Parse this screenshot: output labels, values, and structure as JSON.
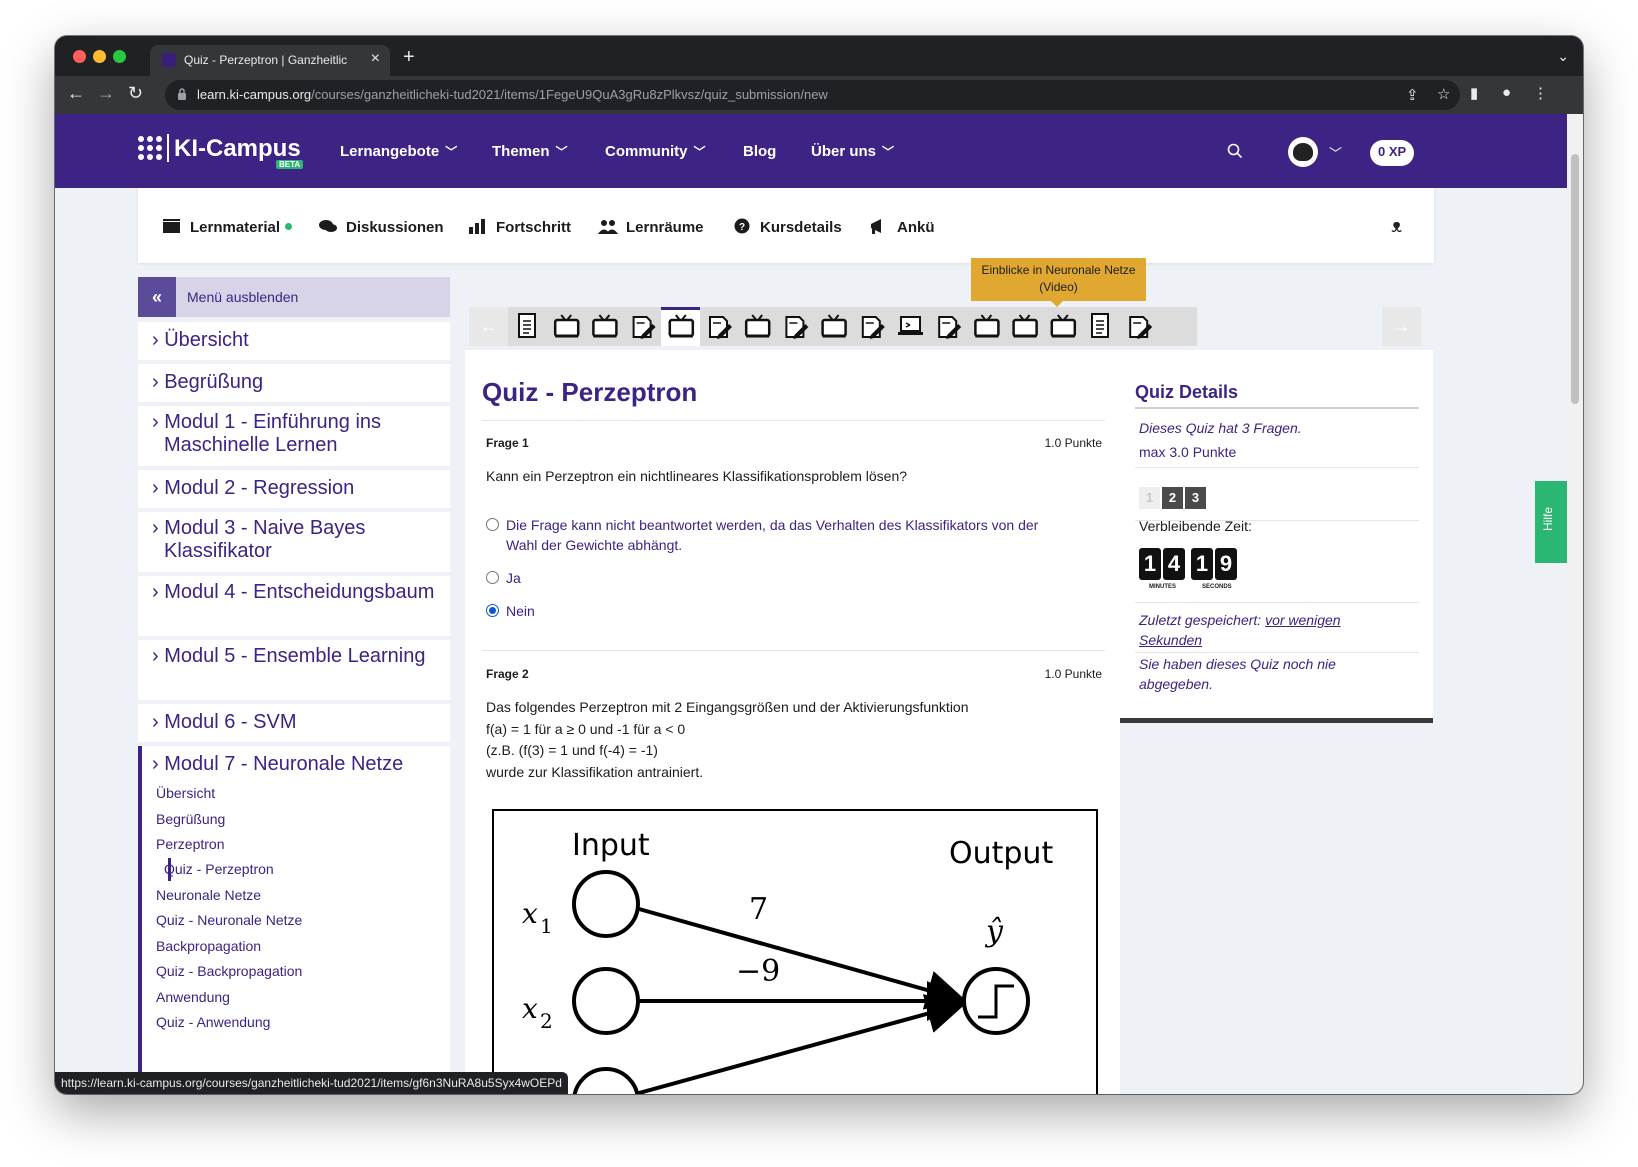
{
  "browser": {
    "tab_title": "Quiz - Perzeptron | Ganzheitlic",
    "tab_close": "×",
    "new_tab": "+",
    "url_host": "learn.ki-campus.org",
    "url_path": "/courses/ganzheitlicheki-tud2021/items/1FegeU9QuA3gRu8zPlkvsz/quiz_submission/new",
    "status_url": "https://learn.ki-campus.org/courses/ganzheitlicheki-tud2021/items/gf6n3NuRA8u5Syx4wOEPd"
  },
  "site": {
    "logo": "KI-Campus",
    "beta": "BETA",
    "nav": [
      "Lernangebote",
      "Themen",
      "Community",
      "Blog",
      "Über uns"
    ],
    "xp": "0 XP"
  },
  "course_tabs": {
    "items": [
      "Lernmaterial",
      "Diskussionen",
      "Fortschritt",
      "Lernräume",
      "Kursdetails",
      "Ankü"
    ],
    "tooltip": "Einblicke in Neuronale Netze (Video)"
  },
  "sidebar": {
    "toggle_label": "Menü ausblenden",
    "modules": [
      "› Übersicht",
      "› Begrüßung",
      "› Modul 1 - Einführung ins Maschinelle Lernen",
      "› Modul 2 - Regression",
      "› Modul 3 - Naive Bayes Klassifikator",
      "› Modul 4 - Entscheidungsbaum",
      "› Modul 5 - Ensemble Learning",
      "› Modul 6 - SVM",
      "› Modul 7 - Neuronale Netze"
    ],
    "submodules": [
      "Übersicht",
      "Begrüßung",
      "Perzeptron",
      "Quiz - Perzeptron",
      "Neuronale Netze",
      "Quiz - Neuronale Netze",
      "Backpropagation",
      "Quiz - Backpropagation",
      "Anwendung",
      "Quiz - Anwendung"
    ]
  },
  "quiz": {
    "title": "Quiz - Perzeptron",
    "q1": {
      "label": "Frage 1",
      "points": "1.0 Punkte",
      "text": "Kann ein Perzeptron ein nichtlineares Klassifikationsproblem lösen?",
      "options": [
        "Die Frage kann nicht beantwortet werden, da das Verhalten des Klassifikators von der Wahl der Gewichte abhängt.",
        "Ja",
        "Nein"
      ],
      "selected": "Nein"
    },
    "q2": {
      "label": "Frage 2",
      "points": "1.0 Punkte",
      "lines": [
        "Das folgendes Perzeptron mit 2 Eingangsgrößen und der Aktivierungsfunktion",
        "f(a) = 1 für a ≥ 0 und -1 für a < 0",
        "(z.B. (f(3) = 1 und f(-4) = -1)",
        "wurde zur Klassifikation antrainiert."
      ]
    },
    "diagram": {
      "input_label": "Input",
      "output_label": "Output",
      "x1": "x",
      "x1_sub": "1",
      "x2": "x",
      "x2_sub": "2",
      "w1": "7",
      "w2": "−9",
      "yhat": "ŷ"
    }
  },
  "details": {
    "title": "Quiz Details",
    "questions_info": "Dieses Quiz hat 3 Fragen.",
    "max_points": "max 3.0 Punkte",
    "pages": [
      "1",
      "2",
      "3"
    ],
    "time_label": "Verbleibende Zeit:",
    "minutes": [
      "1",
      "4"
    ],
    "seconds": [
      "1",
      "9"
    ],
    "minutes_label": "MINUTES",
    "seconds_label": "SECONDS",
    "saved_prefix": "Zuletzt gespeichert:",
    "saved_link": "vor wenigen",
    "saved_link2": "Sekunden",
    "not_submitted_1": "Sie haben dieses Quiz noch nie",
    "not_submitted_2": "abgegeben."
  },
  "help": "Hilfe",
  "colors": {
    "brand_purple": "#3d2383",
    "accent_green": "#2bb673",
    "tooltip_yellow": "#e0a830"
  }
}
